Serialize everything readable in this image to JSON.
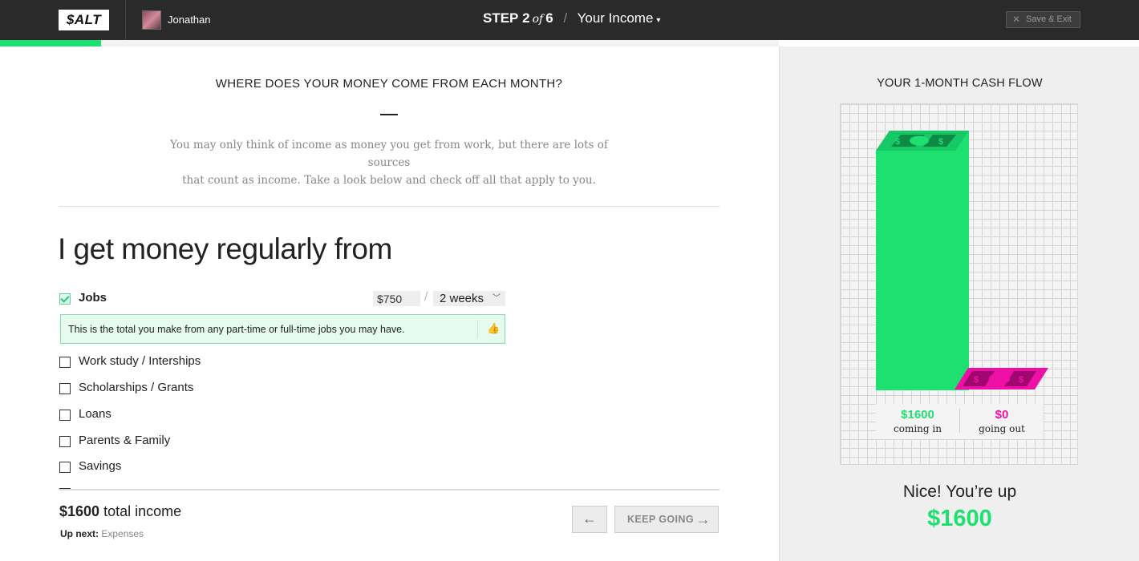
{
  "header": {
    "logo": "$ALT",
    "username": "Jonathan",
    "step_word": "STEP",
    "step_current": "2",
    "step_of": "of",
    "step_total": "6",
    "section": "Your Income",
    "save_exit": "Save & Exit",
    "progress_fraction": 0.13
  },
  "main": {
    "question": "WHERE DOES YOUR MONEY COME FROM EACH MONTH?",
    "intro_line1": "You may only think of income as money you get from work, but there are lots of sources",
    "intro_line2": "that count as income. Take a look below and check off all that apply to you.",
    "title": "I get money regularly from",
    "jobs": {
      "label": "Jobs",
      "checked": true,
      "amount": "$750",
      "period": "2 weeks",
      "tip": "This is the total you make from any part-time or full-time jobs you may have."
    },
    "sources": [
      {
        "label": "Work study / Interships",
        "checked": false
      },
      {
        "label": "Scholarships / Grants",
        "checked": false
      },
      {
        "label": "Loans",
        "checked": false
      },
      {
        "label": "Parents & Family",
        "checked": false
      },
      {
        "label": "Savings",
        "checked": false
      }
    ]
  },
  "footer": {
    "total_amount": "$1600",
    "total_label": "total income",
    "up_next_label": "Up next:",
    "up_next_value": "Expenses",
    "keep_going": "KEEP GOING"
  },
  "sidebar": {
    "title": "YOUR 1-MONTH CASH FLOW",
    "coming_in_value": "$1600",
    "coming_in_label": "coming in",
    "going_out_value": "$0",
    "going_out_label": "going out",
    "nice": "Nice! You’re up",
    "nice_amount": "$1600",
    "colors": {
      "income": "#1de070",
      "expense": "#ee10a4"
    }
  }
}
